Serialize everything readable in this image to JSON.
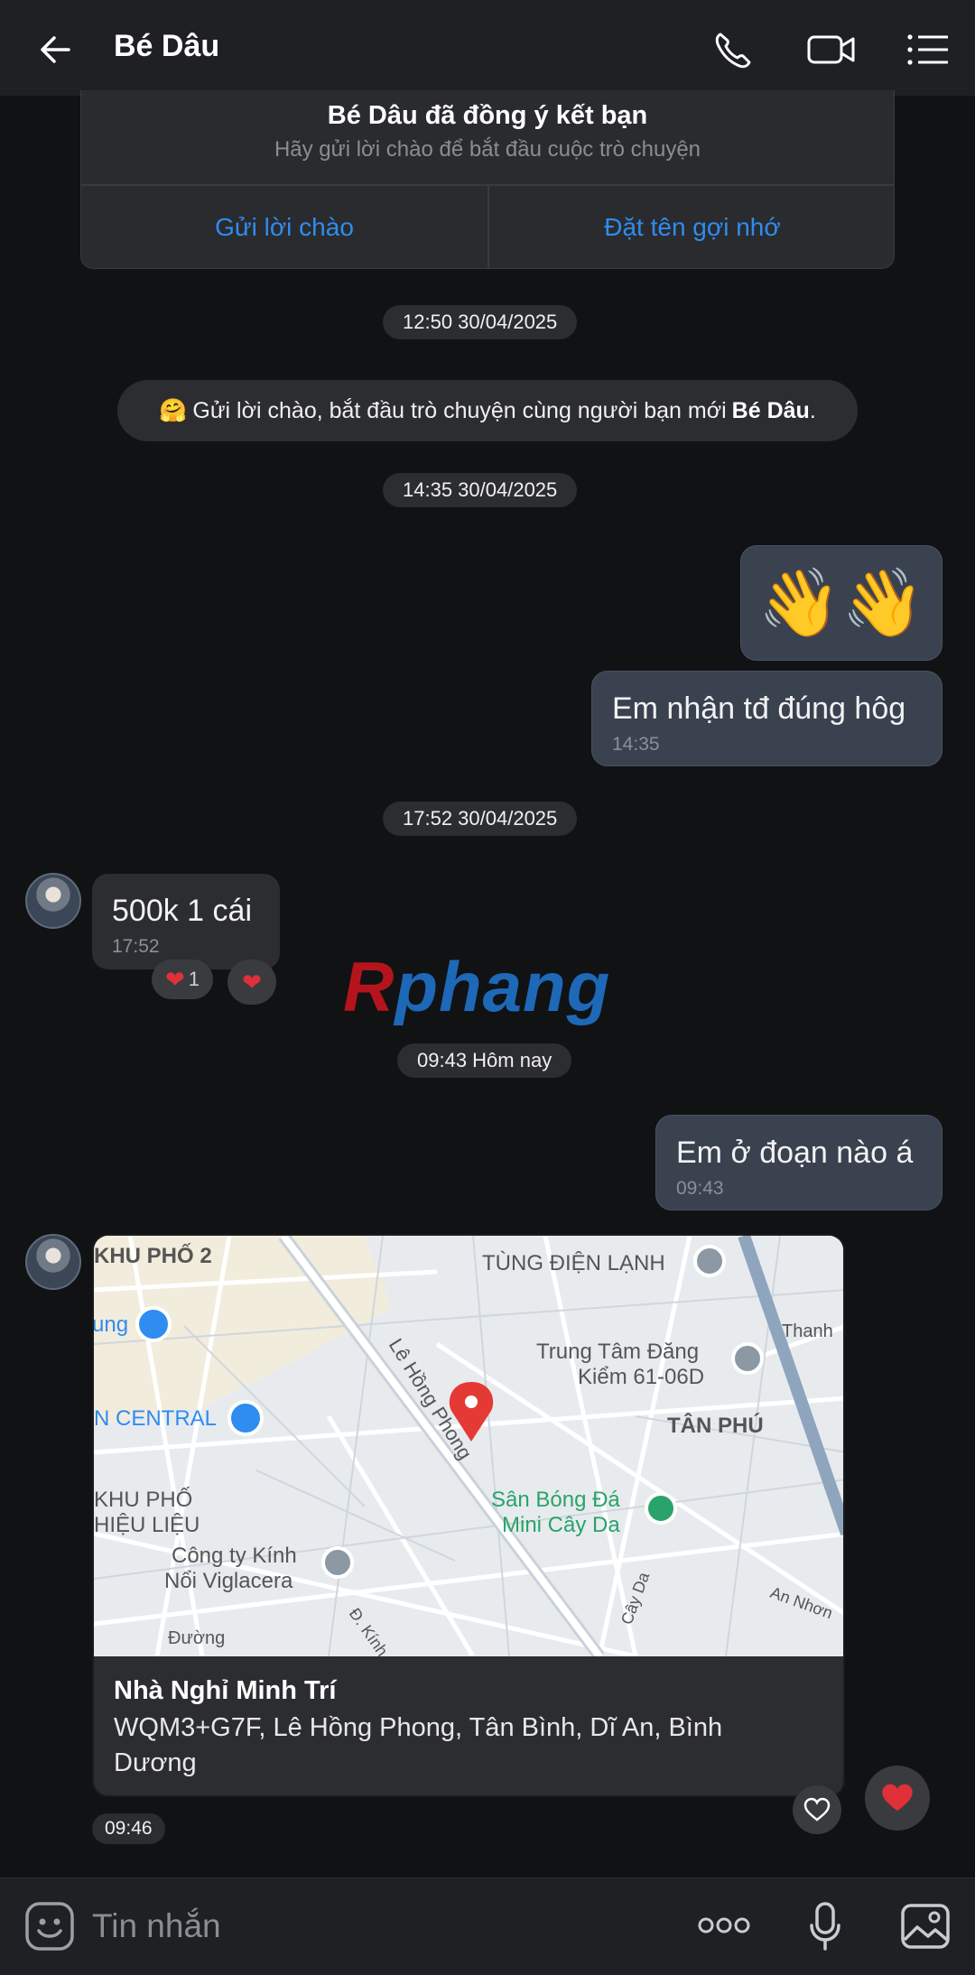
{
  "header": {
    "title": "Bé Dâu"
  },
  "friend_card": {
    "title": "Bé Dâu đã đồng ý kết bạn",
    "subtitle": "Hãy gửi lời chào để bắt đầu cuộc trò chuyện",
    "btn_greet": "Gửi lời chào",
    "btn_nickname": "Đặt tên gợi nhớ"
  },
  "pills": {
    "t1": "12:50 30/04/2025",
    "t2": "14:35 30/04/2025",
    "t3": "17:52 30/04/2025",
    "t4": "09:43 Hôm nay"
  },
  "system_message": {
    "emoji": "🤗",
    "text": "Gửi lời chào, bắt đầu trò chuyện cùng người bạn mới",
    "name": "Bé Dâu",
    "end": "."
  },
  "messages": {
    "wave": "👋👋",
    "m1_text": "Em nhận tđ đúng hôg",
    "m1_time": "14:35",
    "m2_text": "500k 1 cái",
    "m2_time": "17:52",
    "m2_reaction_count": "1",
    "m3_text": "Em ở đoạn nào á",
    "m3_time": "09:43",
    "location_time": "09:46"
  },
  "watermark": {
    "first": "R",
    "rest": "phang"
  },
  "location": {
    "name": "Nhà Nghỉ Minh Trí",
    "address": "WQM3+G7F, Lê Hồng Phong, Tân Bình, Dĩ An, Bình Dương",
    "map_labels": {
      "khu_pho_2": "KHU PHỐ 2",
      "tung_dien_lanh": "TÙNG ĐIỆN LẠNH",
      "ung": "ung",
      "thanh": "Thanh",
      "trung_tam_1": "Trung Tâm Đăng",
      "trung_tam_2": "Kiểm 61-06D",
      "central": "N CENTRAL",
      "le_hong_phong": "Lê Hồng Phong",
      "tan_phu": "TÂN PHÚ",
      "khu_pho_l1": "KHU PHỐ",
      "khu_pho_l2": "HIỆU LIỆU",
      "san_bong_1": "Sân Bóng Đá",
      "san_bong_2": "Mini Cây Da",
      "cty_1": "Công ty Kính",
      "cty_2": "Nổi Viglacera",
      "cay_da": "Cây Da",
      "an_nhon": "An Nhơn",
      "duong": "Đường",
      "d_kinh": "Đ. Kính"
    }
  },
  "input": {
    "placeholder": "Tin nhắn"
  },
  "colors": {
    "accent": "#2f8cf0",
    "heart": "#e0303a",
    "background": "#111214"
  }
}
